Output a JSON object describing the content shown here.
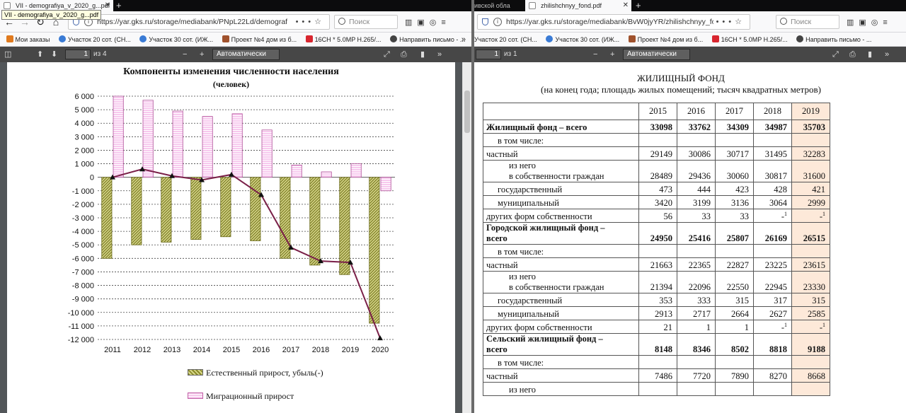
{
  "left_window": {
    "tab_title": "VII - demografiya_v_2020_g...pdf",
    "tooltip": "VII - demografiya_v_2020_g...pdf",
    "url": "https://yar.gks.ru/storage/mediabank/PNpL22Ld/demograf",
    "search_placeholder": "Поиск",
    "bookmarks": [
      {
        "label": "Мои заказы",
        "color": "#e07a1e"
      },
      {
        "label": "Участок 20 сот. (СН...",
        "color": "#3a7bd5"
      },
      {
        "label": "Участок 30 сот. (ИЖ...",
        "color": "#3a7bd5"
      },
      {
        "label": "Проект №4 дом из б...",
        "color": "#a0522d"
      },
      {
        "label": "16CH * 5.0MP H.265/...",
        "color": "#d8262f"
      },
      {
        "label": "Направить письмо - ...",
        "color": "#444444"
      }
    ],
    "pdf": {
      "page": "1",
      "page_total": "из 4",
      "zoom": "Автоматически"
    }
  },
  "right_window": {
    "tab_left_fragment": "ивской обла",
    "tab_title": "zhilishchnyy_fond.pdf",
    "url": "https://yar.gks.ru/storage/mediabank/BvW0jyYR/zhilishchnyy_fond.pdf",
    "search_placeholder": "Поиск",
    "bookmarks": [
      {
        "label": "Участок 20 сот. (СН...",
        "color": "#3a7bd5"
      },
      {
        "label": "Участок 30 сот. (ИЖ...",
        "color": "#3a7bd5"
      },
      {
        "label": "Проект №4 дом из б...",
        "color": "#a0522d"
      },
      {
        "label": "16CH * 5.0MP H.265/...",
        "color": "#d8262f"
      },
      {
        "label": "Направить письмо - ...",
        "color": "#444444"
      }
    ],
    "pdf": {
      "page": "1",
      "page_total": "из 1",
      "zoom": "Автоматически"
    }
  },
  "chart_data": {
    "type": "bar",
    "title": "Компоненты изменения численности населения",
    "subtitle": "(человек)",
    "categories": [
      "2011",
      "2012",
      "2013",
      "2014",
      "2015",
      "2016",
      "2017",
      "2018",
      "2019",
      "2020"
    ],
    "ylim": [
      -12000,
      6000
    ],
    "yticks": [
      6000,
      5000,
      4000,
      3000,
      2000,
      1000,
      0,
      -1000,
      -2000,
      -3000,
      -4000,
      -5000,
      -6000,
      -7000,
      -8000,
      -9000,
      -10000,
      -11000,
      -12000
    ],
    "ytick_labels": [
      "6 000",
      "5 000",
      "4 000",
      "3 000",
      "2 000",
      "1 000",
      "0",
      "-1 000",
      "-2 000",
      "-3 000",
      "-4 000",
      "-5 000",
      "-6 000",
      "-7 000",
      "-8 000",
      "-9 000",
      "-10 000",
      "-11 000",
      "-12 000"
    ],
    "grid": true,
    "legend_position": "bottom",
    "series": [
      {
        "name": "Естественный прирост, убыль(-)",
        "kind": "bar",
        "color": "#a8a84a",
        "values": [
          -6000,
          -5000,
          -4800,
          -4600,
          -4400,
          -4700,
          -6000,
          -6500,
          -7200,
          -10800
        ]
      },
      {
        "name": "Миграционный прирост",
        "kind": "bar",
        "color": "#f6c8ec",
        "values": [
          6000,
          5700,
          4900,
          4500,
          4700,
          3500,
          900,
          400,
          1000,
          -1000
        ]
      },
      {
        "values": [
          0,
          600,
          100,
          -200,
          200,
          -1300,
          -5200,
          -6200,
          -6300,
          -11900
        ],
        "kind": "line",
        "color": "#7a2048"
      }
    ]
  },
  "table": {
    "title": "ЖИЛИЩНЫЙ ФОНД",
    "subtitle": "(на конец года; площадь жилых помещений; тысяч квадратных метров)",
    "years": [
      "2015",
      "2016",
      "2017",
      "2018",
      "2019"
    ],
    "rows": [
      {
        "label": "Жилищный фонд",
        "label_rest": " – всего",
        "bold": true,
        "values": [
          "33098",
          "33762",
          "34309",
          "34987",
          "35703"
        ]
      },
      {
        "label": "в том числе:",
        "indent": 1,
        "values": [
          "",
          "",
          "",
          "",
          ""
        ]
      },
      {
        "label": "частный",
        "values": [
          "29149",
          "30086",
          "30717",
          "31495",
          "32283"
        ]
      },
      {
        "label": "из него",
        "label2": "в собственности граждан",
        "indent": 2,
        "values": [
          "28489",
          "29436",
          "30060",
          "30817",
          "31600"
        ]
      },
      {
        "label": "государственный",
        "indent": 1,
        "values": [
          "473",
          "444",
          "423",
          "428",
          "421"
        ]
      },
      {
        "label": "муниципальный",
        "indent": 1,
        "values": [
          "3420",
          "3199",
          "3136",
          "3064",
          "2999"
        ]
      },
      {
        "label": "других форм собственности",
        "values": [
          "56",
          "33",
          "33",
          "-1",
          "-1"
        ]
      },
      {
        "label": "Городской жилищный фонд –",
        "label2": "всего",
        "bold": true,
        "values": [
          "24950",
          "25416",
          "25807",
          "26169",
          "26515"
        ]
      },
      {
        "label": "в том числе:",
        "indent": 1,
        "values": [
          "",
          "",
          "",
          "",
          ""
        ]
      },
      {
        "label": "частный",
        "values": [
          "21663",
          "22365",
          "22827",
          "23225",
          "23615"
        ]
      },
      {
        "label": "из него",
        "label2": "в собственности граждан",
        "indent": 2,
        "values": [
          "21394",
          "22096",
          "22550",
          "22945",
          "23330"
        ]
      },
      {
        "label": "государственный",
        "indent": 1,
        "values": [
          "353",
          "333",
          "315",
          "317",
          "315"
        ]
      },
      {
        "label": "муниципальный",
        "indent": 1,
        "values": [
          "2913",
          "2717",
          "2664",
          "2627",
          "2585"
        ]
      },
      {
        "label": "других форм собственности",
        "values": [
          "21",
          "1",
          "1",
          "-1",
          "-1"
        ]
      },
      {
        "label": "Сельский жилищный фонд –",
        "label2": "всего",
        "bold": true,
        "values": [
          "8148",
          "8346",
          "8502",
          "8818",
          "9188"
        ]
      },
      {
        "label": "в том числе:",
        "indent": 1,
        "values": [
          "",
          "",
          "",
          "",
          ""
        ]
      },
      {
        "label": "частный",
        "values": [
          "7486",
          "7720",
          "7890",
          "8270",
          "8668"
        ]
      },
      {
        "label": "из него",
        "indent": 2,
        "values": [
          "",
          "",
          "",
          "",
          ""
        ]
      }
    ]
  }
}
